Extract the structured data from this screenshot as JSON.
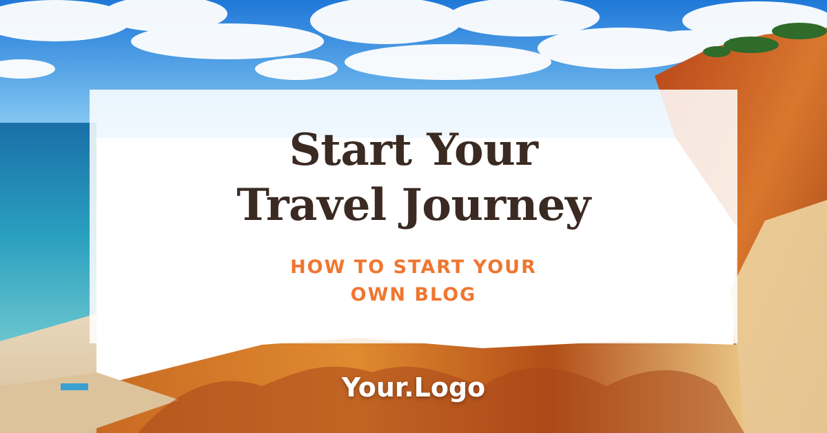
{
  "headline": {
    "line1": "Start Your",
    "line2": "Travel Journey"
  },
  "subtitle": {
    "line1": "HOW TO START YOUR",
    "line2": "OWN BLOG"
  },
  "logo": "Your.Logo",
  "colors": {
    "headline": "#3a2a22",
    "subtitle": "#f07630",
    "logo": "#ffffff",
    "sky": "#2f8fe0",
    "sea": "#1f86b5",
    "cliff": "#c35a20"
  }
}
